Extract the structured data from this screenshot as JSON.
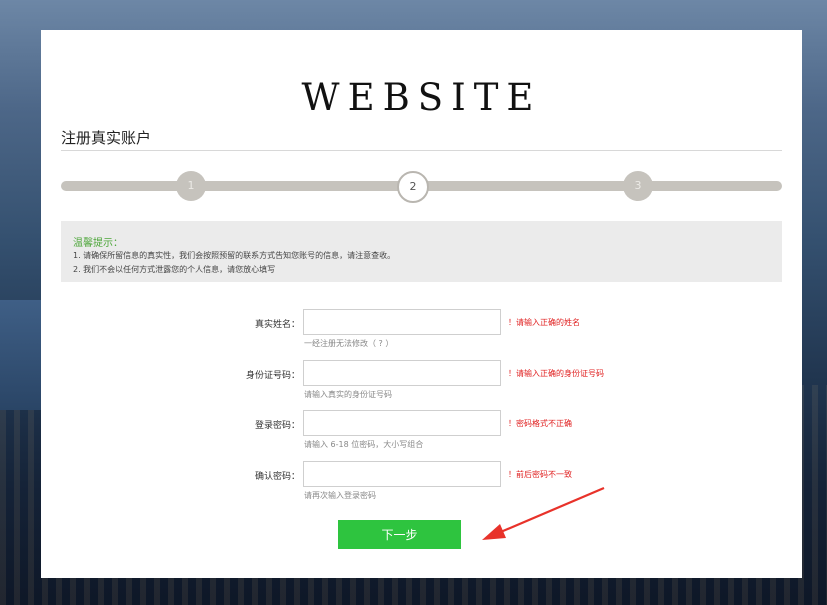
{
  "brand": {
    "logo_text": "WEBSITE"
  },
  "page": {
    "title": "注册真实账户"
  },
  "stepper": {
    "steps": [
      "1",
      "2",
      "3"
    ],
    "current_step": 2
  },
  "notice": {
    "title": "温馨提示：",
    "lines": [
      "1. 请确保所留信息的真实性，我们会按照预留的联系方式告知您账号的信息，请注意查收。",
      "2. 我们不会以任何方式泄露您的个人信息，请您放心填写"
    ]
  },
  "form": {
    "fields": [
      {
        "label": "真实姓名：",
        "value": "",
        "hint": "一经注册无法修改（ ? ）",
        "error": "！请输入正确的姓名"
      },
      {
        "label": "身份证号码：",
        "value": "",
        "hint": "请输入真实的身份证号码",
        "error": "！请输入正确的身份证号码"
      },
      {
        "label": "登录密码：",
        "value": "",
        "hint": "请输入 6-18 位密码，大小写组合",
        "error": "！密码格式不正确"
      },
      {
        "label": "确认密码：",
        "value": "",
        "hint": "请再次输入登录密码",
        "error": "！前后密码不一致"
      }
    ],
    "submit_label": "下一步"
  },
  "colors": {
    "accent_green": "#2ec43f",
    "notice_green": "#4da63a",
    "error_red": "#e02020",
    "annotation_arrow": "#e8322a"
  },
  "annotation": {
    "icon": "red-arrow-icon"
  }
}
